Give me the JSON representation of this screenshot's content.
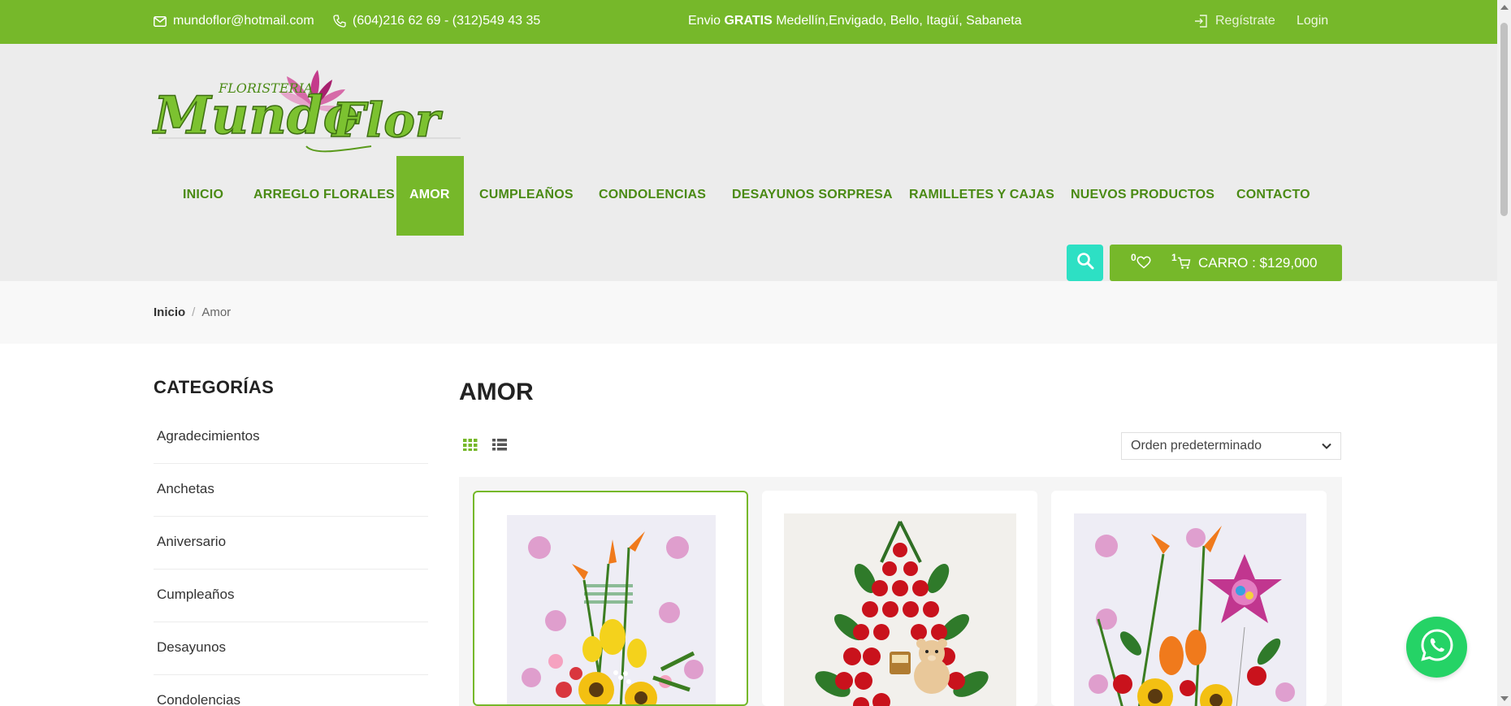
{
  "topbar": {
    "email": "mundoflor@hotmail.com",
    "phone": "(604)216 62 69 - (312)549 43 35",
    "shipping_prefix": "Envio",
    "shipping_bold": "GRATIS",
    "shipping_rest": "Medellín,Envigado, Bello, Itagüí, Sabaneta",
    "register": "Regístrate",
    "login": "Login"
  },
  "logo": {
    "small_text": "FLORISTERIA",
    "main_text": "MundoFlor"
  },
  "nav": {
    "items": [
      {
        "label": "INICIO"
      },
      {
        "label": "ARREGLO FLORALES"
      },
      {
        "label": "AMOR",
        "active": true
      },
      {
        "label": "CUMPLEAÑOS"
      },
      {
        "label": "CONDOLENCIAS"
      },
      {
        "label": "DESAYUNOS SORPRESA"
      },
      {
        "label": "RAMILLETES Y CAJAS"
      },
      {
        "label": "NUEVOS PRODUCTOS"
      },
      {
        "label": "CONTACTO"
      }
    ]
  },
  "cart": {
    "wishlist_count": "0",
    "cart_count": "1",
    "label": "CARRO : $129,000"
  },
  "breadcrumb": {
    "home": "Inicio",
    "separator": "/",
    "current": "Amor"
  },
  "sidebar": {
    "title": "CATEGORÍAS",
    "categories": [
      "Agradecimientos",
      "Anchetas",
      "Aniversario",
      "Cumpleaños",
      "Desayunos",
      "Condolencias"
    ]
  },
  "main": {
    "title": "AMOR",
    "sort_label": "Orden predeterminado"
  },
  "colors": {
    "brand_green": "#76b82a",
    "nav_text": "#4a8a14",
    "search_teal": "#2de0c4",
    "whatsapp": "#25d366"
  },
  "icons": [
    "mail-icon",
    "phone-icon",
    "login-icon",
    "search-icon",
    "heart-icon",
    "cart-icon",
    "grid-view-icon",
    "list-view-icon",
    "chevron-down-icon",
    "whatsapp-icon"
  ]
}
